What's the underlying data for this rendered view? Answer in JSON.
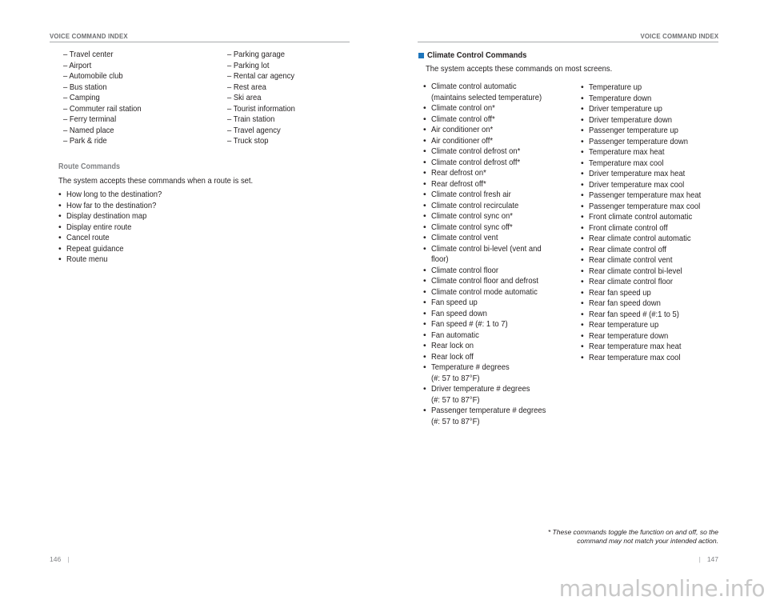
{
  "left_page": {
    "running_head": "VOICE COMMAND INDEX",
    "place_categories_col1": [
      "– Travel center",
      "– Airport",
      "– Automobile club",
      "– Bus station",
      "– Camping",
      "– Commuter rail station",
      "– Ferry terminal",
      "– Named place",
      "– Park & ride"
    ],
    "place_categories_col2": [
      "– Parking garage",
      "– Parking lot",
      "– Rental car agency",
      "– Rest area",
      "– Ski area",
      "– Tourist information",
      "– Train station",
      "– Travel agency",
      "– Truck stop"
    ],
    "route_commands": {
      "heading": "Route Commands",
      "intro": "The system accepts these commands when a route is set.",
      "items": [
        "How long to the destination?",
        "How far to the destination?",
        "Display destination map",
        "Display entire route",
        "Cancel route",
        "Repeat guidance",
        "Route menu"
      ]
    },
    "page_number": "146",
    "separator": "|"
  },
  "right_page": {
    "running_head": "VOICE COMMAND INDEX",
    "section": {
      "heading": "Climate Control Commands",
      "marker_color": "#1d75bc",
      "intro": "The system accepts these commands on most screens.",
      "col1": [
        [
          "Climate control automatic",
          "(maintains selected temperature)"
        ],
        [
          "Climate control on*"
        ],
        [
          "Climate control off*"
        ],
        [
          "Air conditioner on*"
        ],
        [
          "Air conditioner off*"
        ],
        [
          "Climate control defrost on*"
        ],
        [
          "Climate control defrost off*"
        ],
        [
          "Rear defrost on*"
        ],
        [
          "Rear defrost off*"
        ],
        [
          "Climate control fresh air"
        ],
        [
          "Climate control recirculate"
        ],
        [
          "Climate control sync on*"
        ],
        [
          "Climate control sync off*"
        ],
        [
          "Climate control vent"
        ],
        [
          "Climate control bi-level (vent and",
          "floor)"
        ],
        [
          "Climate control floor"
        ],
        [
          "Climate control floor and defrost"
        ],
        [
          "Climate control mode automatic"
        ],
        [
          "Fan speed up"
        ],
        [
          "Fan speed down"
        ],
        [
          "Fan speed # (#: 1 to 7)"
        ],
        [
          "Fan automatic"
        ],
        [
          "Rear lock on"
        ],
        [
          "Rear lock off"
        ],
        [
          "Temperature # degrees",
          "(#: 57 to 87°F)"
        ],
        [
          "Driver temperature # degrees",
          "(#: 57 to 87°F)"
        ],
        [
          "Passenger temperature # degrees",
          "(#: 57 to 87°F)"
        ]
      ],
      "col2": [
        "Temperature up",
        "Temperature down",
        "Driver temperature up",
        "Driver temperature down",
        "Passenger temperature up",
        "Passenger temperature down",
        "Temperature max heat",
        "Temperature max cool",
        "Driver temperature max heat",
        "Driver temperature max cool",
        "Passenger temperature max heat",
        "Passenger temperature max cool",
        "Front climate control automatic",
        "Front climate control off",
        "Rear climate control automatic",
        "Rear climate control off",
        "Rear climate control vent",
        "Rear climate control bi-level",
        "Rear climate control floor",
        "Rear fan speed up",
        "Rear fan speed down",
        "Rear fan speed # (#:1 to 5)",
        "Rear temperature up",
        "Rear temperature down",
        "Rear temperature max heat",
        "Rear temperature max cool"
      ]
    },
    "footnote": [
      "* These commands toggle the function on and off, so the",
      "command may not match your intended action."
    ],
    "page_number": "147",
    "separator": "|"
  },
  "watermark": "manualsonline.info"
}
